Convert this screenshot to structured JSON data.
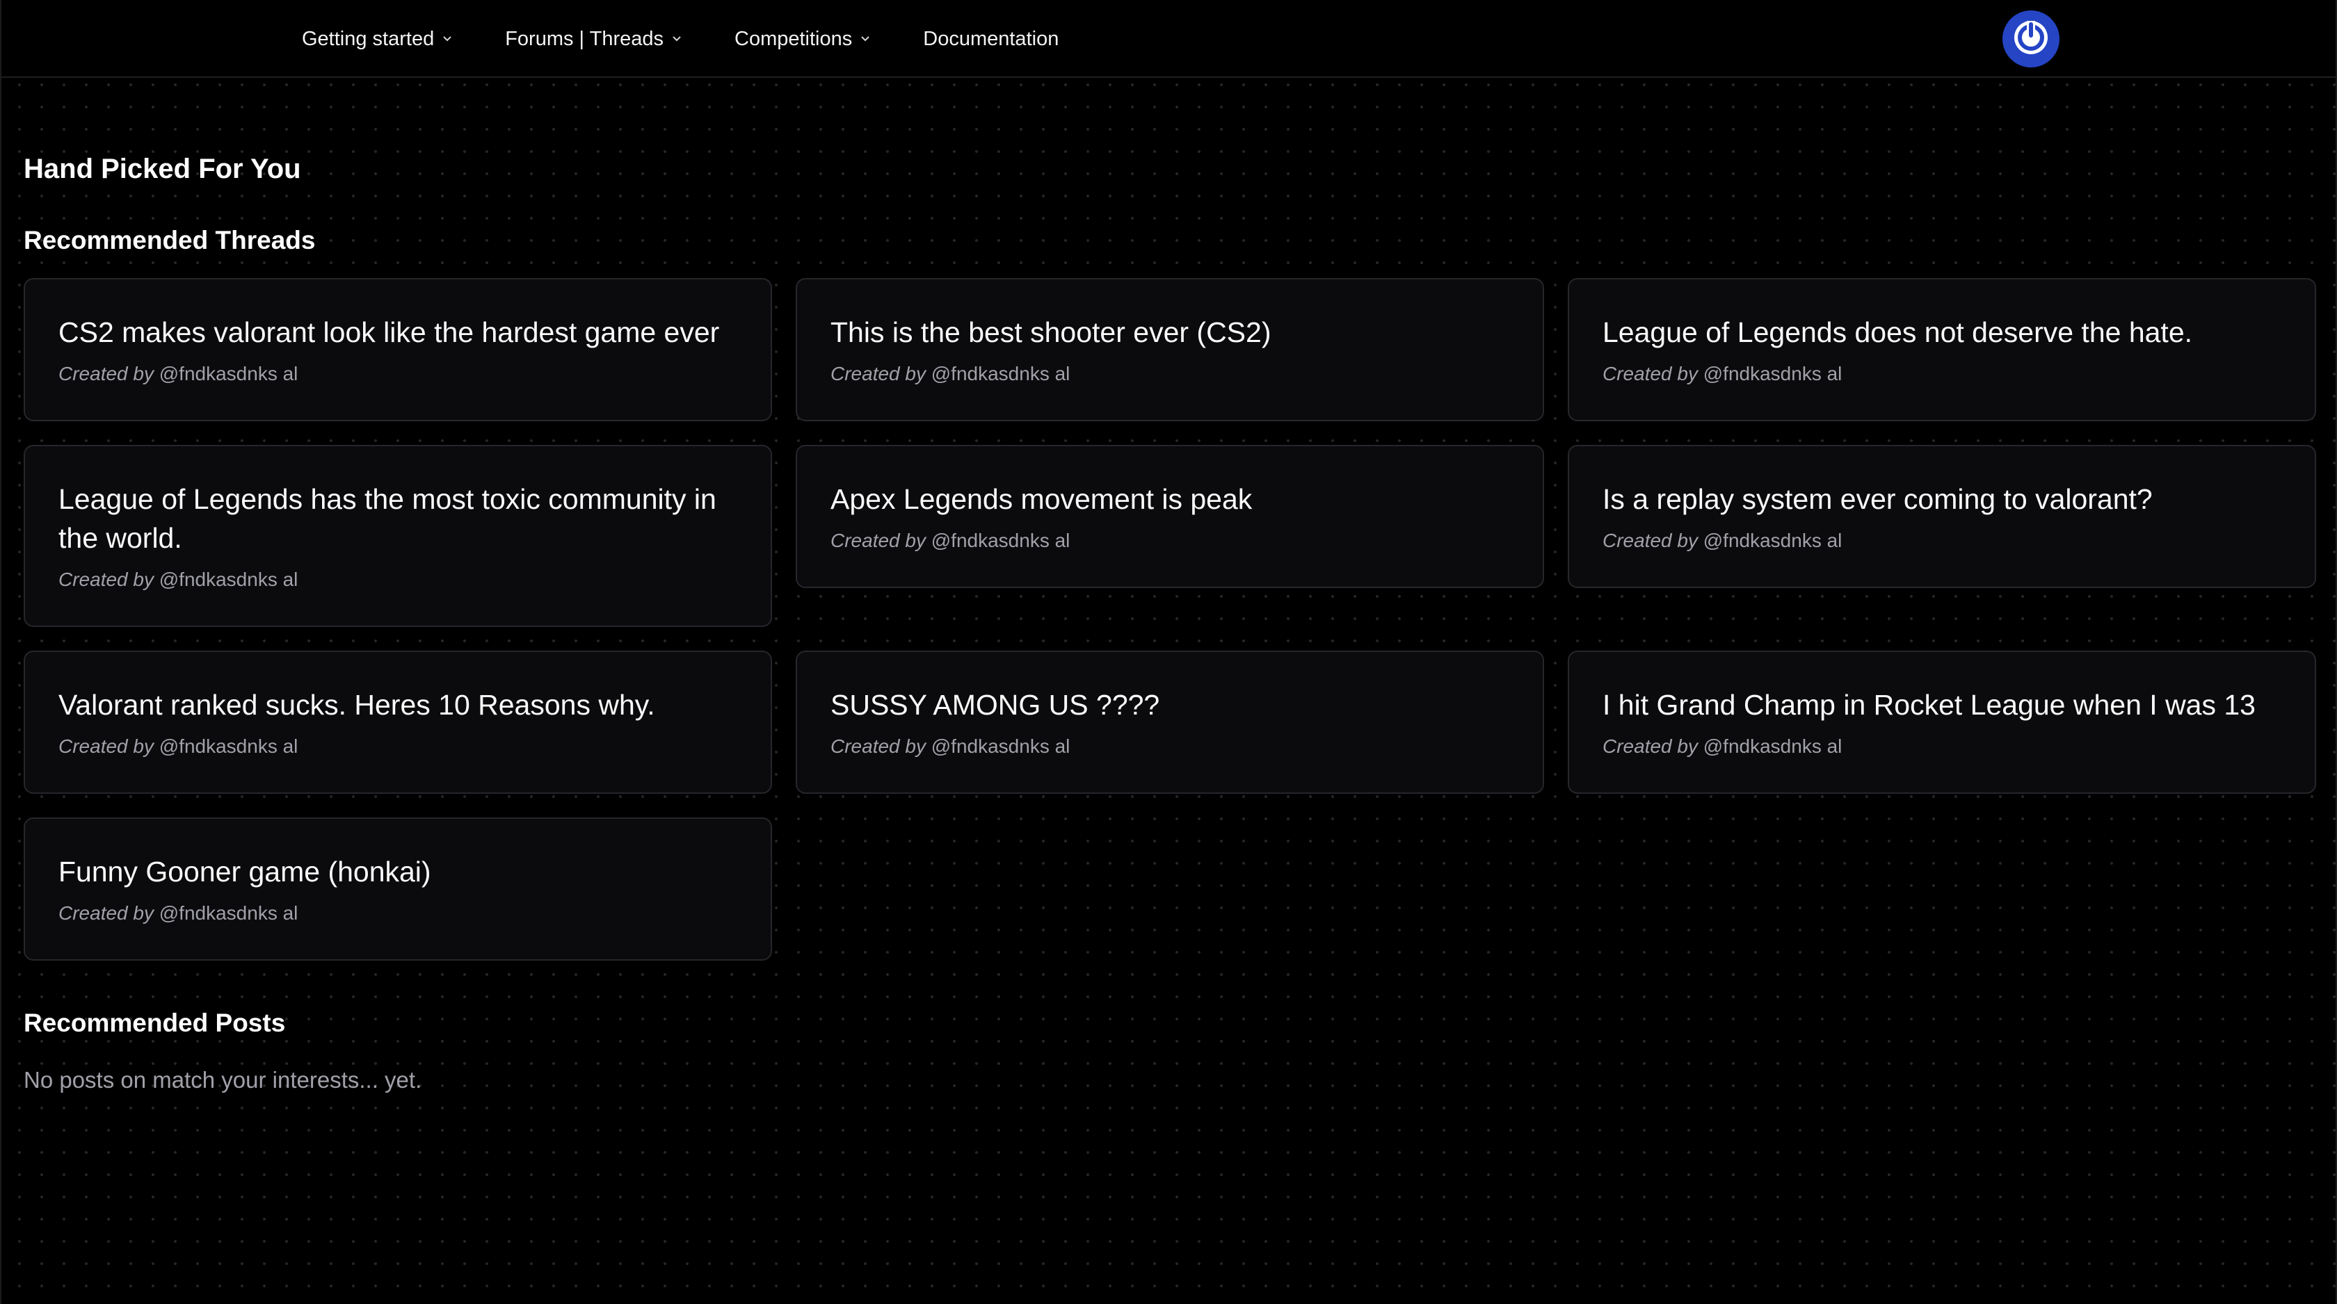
{
  "nav": {
    "items": [
      {
        "label": "Getting started",
        "has_dropdown": true
      },
      {
        "label": "Forums | Threads",
        "has_dropdown": true
      },
      {
        "label": "Competitions",
        "has_dropdown": true
      },
      {
        "label": "Documentation",
        "has_dropdown": false
      }
    ],
    "power_icon": "power-icon",
    "accent_color": "#2545c5"
  },
  "main": {
    "title": "Hand Picked For You",
    "threads": {
      "heading": "Recommended Threads",
      "created_by_label": "Created by",
      "items": [
        {
          "title": "CS2 makes valorant look like the hardest game ever",
          "author": "@fndkasdnks al"
        },
        {
          "title": "This is the best shooter ever (CS2)",
          "author": "@fndkasdnks al"
        },
        {
          "title": "League of Legends does not deserve the hate.",
          "author": "@fndkasdnks al"
        },
        {
          "title": "League of Legends has the most toxic community in the world.",
          "author": "@fndkasdnks al"
        },
        {
          "title": "Apex Legends movement is peak",
          "author": "@fndkasdnks al"
        },
        {
          "title": "Is a replay system ever coming to valorant?",
          "author": "@fndkasdnks al"
        },
        {
          "title": "Valorant ranked sucks. Heres 10 Reasons why.",
          "author": "@fndkasdnks al"
        },
        {
          "title": "SUSSY AMONG US ????",
          "author": "@fndkasdnks al"
        },
        {
          "title": "I hit Grand Champ in Rocket League when I was 13",
          "author": "@fndkasdnks al"
        },
        {
          "title": "Funny Gooner game (honkai)",
          "author": "@fndkasdnks al"
        }
      ]
    },
    "posts": {
      "heading": "Recommended Posts",
      "empty_text": "No posts on match your interests... yet."
    }
  }
}
